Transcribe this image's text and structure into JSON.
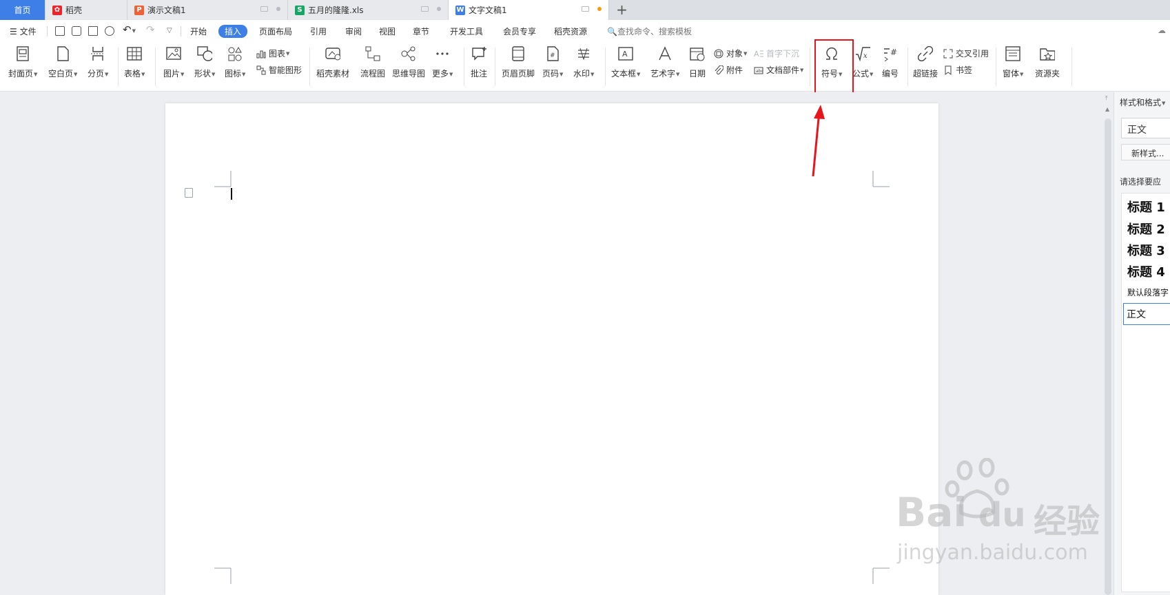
{
  "tabs": [
    {
      "label": "首页",
      "icon": "home"
    },
    {
      "label": "稻壳",
      "icon": "docer-icon",
      "color": "#e8262b"
    },
    {
      "label": "演示文稿1",
      "icon": "presentation-icon",
      "color": "#f06236"
    },
    {
      "label": "五月的隆隆.xls",
      "icon": "spreadsheet-icon",
      "color": "#18a566"
    },
    {
      "label": "文字文稿1",
      "icon": "writer-icon",
      "color": "#3d7fe6"
    }
  ],
  "menu": {
    "file": "文件",
    "items": [
      "开始",
      "插入",
      "页面布局",
      "引用",
      "审阅",
      "视图",
      "章节",
      "开发工具",
      "会员专享",
      "稻壳资源"
    ],
    "active": "插入",
    "search": "查找命令、搜索模板"
  },
  "ribbon": {
    "cover": "封面页",
    "blank": "空白页",
    "pagebreak": "分页",
    "table": "表格",
    "picture": "图片",
    "shape": "形状",
    "icons": "图标",
    "chart": "图表",
    "smartart": "智能图形",
    "docer_material": "稻壳素材",
    "flowchart": "流程图",
    "mindmap": "思维导图",
    "more": "更多",
    "comment": "批注",
    "header_footer": "页眉页脚",
    "page_number": "页码",
    "watermark": "水印",
    "textbox": "文本框",
    "wordart": "艺术字",
    "date": "日期",
    "object": "对象",
    "attachment": "附件",
    "dropcap": "首字下沉",
    "docparts": "文档部件",
    "symbol": "符号",
    "formula": "公式",
    "numbering": "编号",
    "hyperlink": "超链接",
    "crossref": "交叉引用",
    "bookmark": "书签",
    "window": "窗体",
    "resources": "资源夹"
  },
  "rightpane": {
    "title": "样式和格式",
    "current": "正文",
    "new_style": "新样式...",
    "hint": "请选择要应",
    "styles": [
      "标题 1",
      "标题 2",
      "标题 3",
      "标题 4",
      "默认段落字",
      "正文"
    ]
  },
  "watermark": {
    "brand": "Bai",
    "brand2": "du",
    "cn": "经验",
    "url": "jingyan.baidu.com"
  },
  "colors": {
    "accent": "#3d7fe6",
    "highlight": "#e8141b"
  }
}
